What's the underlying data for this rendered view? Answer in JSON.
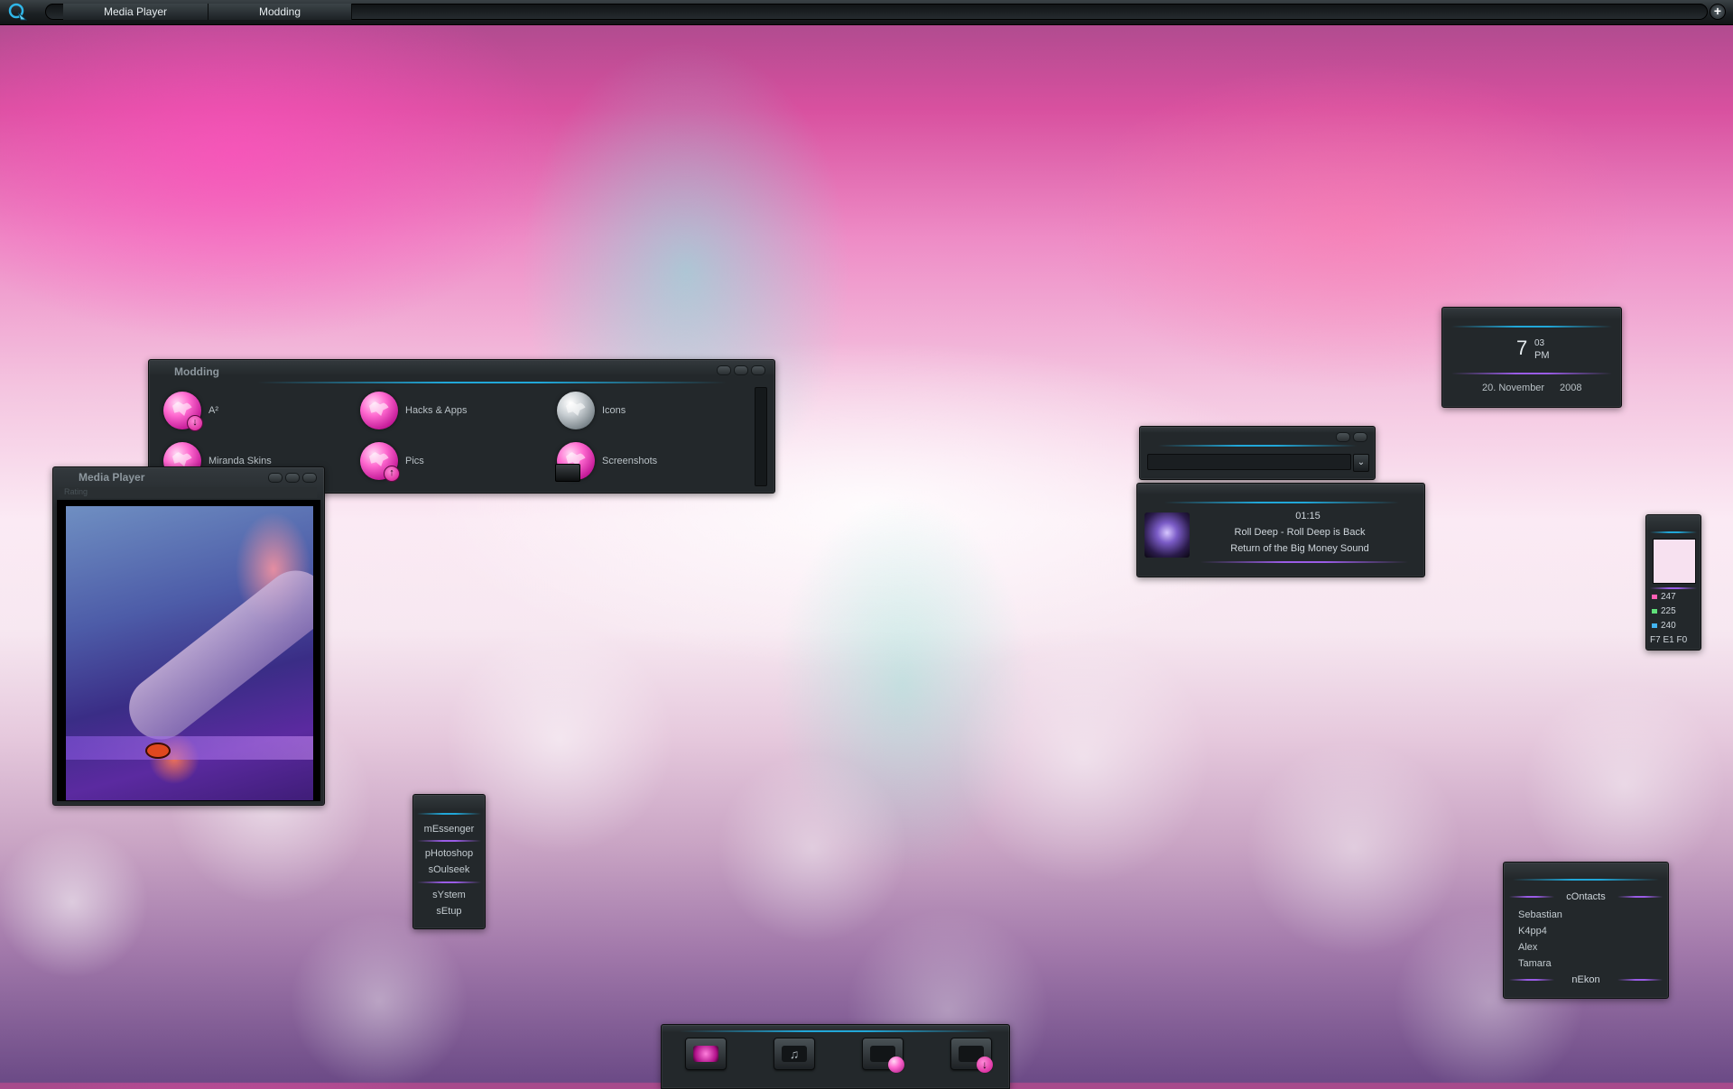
{
  "taskbar": {
    "buttons": [
      "Media Player",
      "Modding"
    ],
    "tray_add_glyph": "+"
  },
  "modding_window": {
    "title": "Modding",
    "items": [
      {
        "label": "A²",
        "icon": "pink-globe-download-icon"
      },
      {
        "label": "Hacks & Apps",
        "icon": "pink-globe-icon"
      },
      {
        "label": "Icons",
        "icon": "grey-globe-icon"
      },
      {
        "label": "Miranda Skins",
        "icon": "pink-globe-icon"
      },
      {
        "label": "Pics",
        "icon": "pink-globe-upload-icon"
      },
      {
        "label": "Screenshots",
        "icon": "pink-globe-folder-icon"
      }
    ]
  },
  "media_player": {
    "title": "Media Player",
    "subtitle": "Rating"
  },
  "clock": {
    "hour": "7",
    "minute": "03",
    "ampm": "PM",
    "day_month": "20. November",
    "year": "2008"
  },
  "search_widget": {
    "value": ""
  },
  "now_playing": {
    "time": "01:15",
    "track": "Roll Deep - Roll Deep is Back",
    "album": "Return of the Big Money Sound",
    "art_icon": "album-art-icon"
  },
  "color_picker": {
    "r": "247",
    "g": "225",
    "b": "240",
    "hex": "F7 E1 F0",
    "swatch": "#F7E1F0"
  },
  "launcher_menu": {
    "items": [
      "mEssenger",
      "pHotoshop",
      "sOulseek",
      "sYstem",
      "sEtup"
    ]
  },
  "contacts": {
    "title": "cOntacts",
    "names": [
      "Sebastian",
      "K4pp4",
      "Alex",
      "Tamara"
    ],
    "footer": "nEkon"
  },
  "dock": {
    "icons": [
      "pictures-drive-icon",
      "music-drive-icon",
      "web-drive-icon",
      "download-drive-icon"
    ]
  },
  "colors": {
    "accent_blue": "#21a7d8",
    "accent_purple": "#9a5ce6",
    "panel": "#23282b",
    "pink": "#ff6ad0"
  }
}
